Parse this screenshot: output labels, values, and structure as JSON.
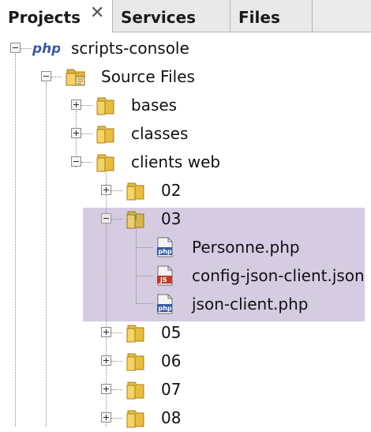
{
  "tabs": [
    {
      "label": "Projects",
      "close": "✕"
    },
    {
      "label": "Services"
    },
    {
      "label": "Files"
    }
  ],
  "tree": {
    "project": "scripts-console",
    "project_icon_text": "php",
    "source_files": "Source Files",
    "folders": [
      "bases",
      "classes",
      "clients web"
    ],
    "subfolders": [
      "02",
      "03",
      "05",
      "06",
      "07",
      "08"
    ],
    "files": [
      {
        "name": "Personne.php",
        "badge": "php"
      },
      {
        "name": "config-json-client.json",
        "badge": "JS"
      },
      {
        "name": "json-client.php",
        "badge": "php"
      }
    ]
  },
  "colors": {
    "selection": "#d5cce2",
    "folder": "#f2c94c",
    "php_icon": "#3b5aa8",
    "json_icon": "#c0392b"
  }
}
